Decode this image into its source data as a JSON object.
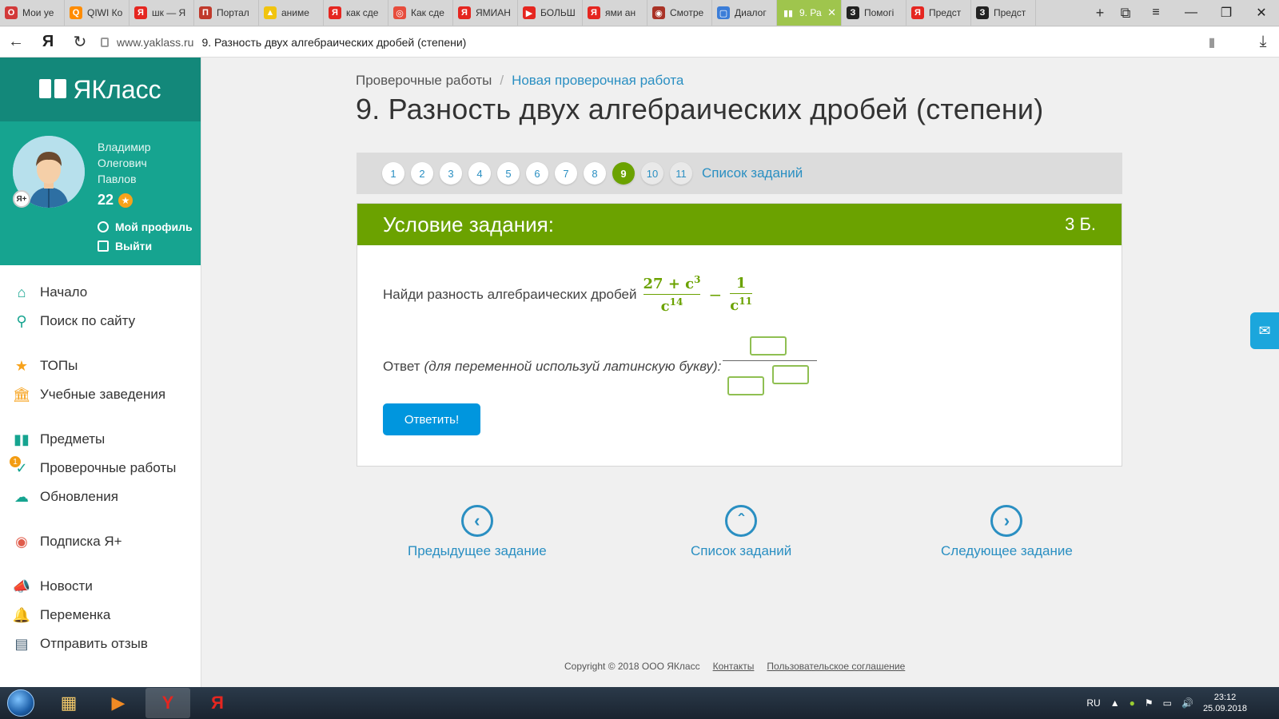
{
  "browser": {
    "tabs": [
      {
        "label": "Мои уе",
        "fav": "opera-icon",
        "color": "#d23a3a",
        "glyph": "O"
      },
      {
        "label": "QIWI Ко",
        "fav": "qiwi-icon",
        "color": "#ff8c00",
        "glyph": "Q"
      },
      {
        "label": "шк — Я",
        "fav": "yandex-icon",
        "color": "#e52620",
        "glyph": "Я"
      },
      {
        "label": "Портал",
        "fav": "portal-icon",
        "color": "#c0392b",
        "glyph": "П"
      },
      {
        "label": "аниме",
        "fav": "image-icon",
        "color": "#f1c40f",
        "glyph": "▲"
      },
      {
        "label": "как сде",
        "fav": "yandex-icon",
        "color": "#e52620",
        "glyph": "Я"
      },
      {
        "label": "Как сде",
        "fav": "lifebuoy-icon",
        "color": "#e74c3c",
        "glyph": "◎"
      },
      {
        "label": "ЯМИАН",
        "fav": "yandex-icon",
        "color": "#e52620",
        "glyph": "Я"
      },
      {
        "label": "БОЛЬШ",
        "fav": "youtube-icon",
        "color": "#e52620",
        "glyph": "▶"
      },
      {
        "label": "ями ан",
        "fav": "yandex-icon",
        "color": "#e52620",
        "glyph": "Я"
      },
      {
        "label": "Смотре",
        "fav": "anime-icon",
        "color": "#a93226",
        "glyph": "◉"
      },
      {
        "label": "Диалог",
        "fav": "chat-icon",
        "color": "#3b7dd8",
        "glyph": "▢"
      },
      {
        "label": "9. Ра",
        "fav": "yaklass-icon",
        "color": "#ffffff",
        "glyph": "▮▮",
        "active": true
      },
      {
        "label": "Помогі",
        "fav": "znanija-icon",
        "color": "#222222",
        "glyph": "З"
      },
      {
        "label": "Предст",
        "fav": "yandex-icon",
        "color": "#e52620",
        "glyph": "Я"
      },
      {
        "label": "Предст",
        "fav": "znanija-icon",
        "color": "#222222",
        "glyph": "З"
      }
    ],
    "url_domain": "www.yaklass.ru",
    "url_title": "9. Разность двух алгебраических дробей (степени)"
  },
  "sidebar": {
    "logo": "ЯКласс",
    "user": {
      "first": "Владимир",
      "middle": "Олегович",
      "last": "Павлов",
      "points": "22",
      "badge": "Я+"
    },
    "profile_link": "Мой профиль",
    "logout_link": "Выйти",
    "menu": [
      {
        "label": "Начало",
        "icon": "home-icon"
      },
      {
        "label": "Поиск по сайту",
        "icon": "search-icon"
      },
      {
        "label": "ТОПы",
        "icon": "star-icon"
      },
      {
        "label": "Учебные заведения",
        "icon": "school-icon"
      },
      {
        "label": "Предметы",
        "icon": "subjects-icon"
      },
      {
        "label": "Проверочные работы",
        "icon": "tests-icon",
        "badge": "1"
      },
      {
        "label": "Обновления",
        "icon": "cloud-icon"
      },
      {
        "label": "Подписка Я+",
        "icon": "subscription-icon"
      },
      {
        "label": "Новости",
        "icon": "news-icon"
      },
      {
        "label": "Переменка",
        "icon": "bell-icon"
      },
      {
        "label": "Отправить отзыв",
        "icon": "feedback-icon"
      }
    ]
  },
  "main": {
    "breadcrumb": {
      "root": "Проверочные работы",
      "separator": "/",
      "current": "Новая проверочная работа"
    },
    "title": "9. Разность двух алгебраических дробей (степени)",
    "task_numbers": [
      "1",
      "2",
      "3",
      "4",
      "5",
      "6",
      "7",
      "8",
      "9",
      "10",
      "11"
    ],
    "active_task": "9",
    "task_list_link": "Список заданий",
    "card": {
      "heading": "Условие задания:",
      "points": "3 Б.",
      "question_text": "Найди разность алгебраических дробей",
      "frac1_num": "27 + c",
      "frac1_num_exp": "3",
      "frac1_den": "c",
      "frac1_den_exp": "14",
      "minus": "−",
      "frac2_num": "1",
      "frac2_den": "c",
      "frac2_den_exp": "11",
      "answer_label": "Ответ",
      "answer_hint": "(для переменной используй латинскую букву):",
      "submit": "Ответить!"
    },
    "bottom_nav": {
      "prev": "Предыдущее задание",
      "list": "Список заданий",
      "next": "Следующее задание"
    },
    "footer": {
      "copyright": "Copyright © 2018 ООО ЯКласс",
      "contacts": "Контакты",
      "agreement": "Пользовательское соглашение"
    }
  },
  "taskbar": {
    "lang": "RU",
    "time": "23:12",
    "date": "25.09.2018"
  },
  "colors": {
    "accent_green": "#6ba200",
    "brand_teal": "#16a490",
    "link_blue": "#2a8fc2",
    "button_blue": "#0096de"
  }
}
